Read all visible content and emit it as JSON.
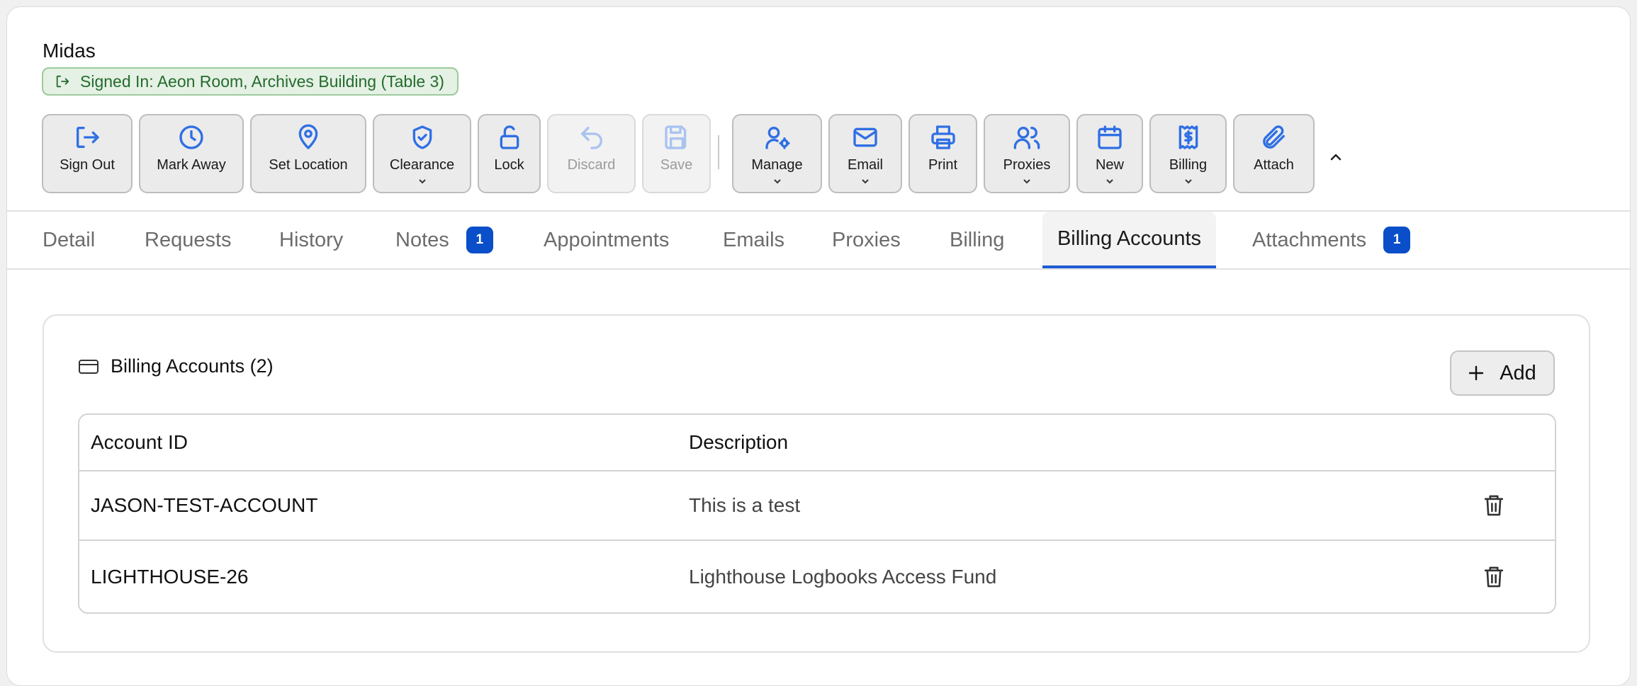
{
  "header": {
    "patron_name": "Midas",
    "signed_in_text": "Signed In: Aeon Room, Archives Building (Table 3)"
  },
  "toolbar": {
    "sign_out": "Sign Out",
    "mark_away": "Mark Away",
    "set_location": "Set Location",
    "clearance": "Clearance",
    "lock": "Lock",
    "discard": "Discard",
    "save": "Save",
    "manage": "Manage",
    "email": "Email",
    "print": "Print",
    "proxies": "Proxies",
    "new": "New",
    "billing": "Billing",
    "attach": "Attach"
  },
  "tabs": {
    "detail": "Detail",
    "requests": "Requests",
    "history": "History",
    "notes": "Notes",
    "notes_count": "1",
    "appointments": "Appointments",
    "emails": "Emails",
    "proxies": "Proxies",
    "billing": "Billing",
    "billing_accounts": "Billing Accounts",
    "attachments": "Attachments",
    "attachments_count": "1"
  },
  "billing_accounts": {
    "title": "Billing Accounts (2)",
    "add_label": "Add",
    "columns": {
      "account_id": "Account ID",
      "description": "Description"
    },
    "rows": [
      {
        "account_id": "JASON-TEST-ACCOUNT",
        "description": "This is a test"
      },
      {
        "account_id": "LIGHTHOUSE-26",
        "description": "Lighthouse Logbooks Access Fund"
      }
    ]
  },
  "colors": {
    "accent": "#2f6fe4",
    "active_tab_underline": "#1f5bd6",
    "badge": "#0a4fc9",
    "signed_in_bg": "#e5f1e5",
    "signed_in_text": "#246b2c"
  }
}
